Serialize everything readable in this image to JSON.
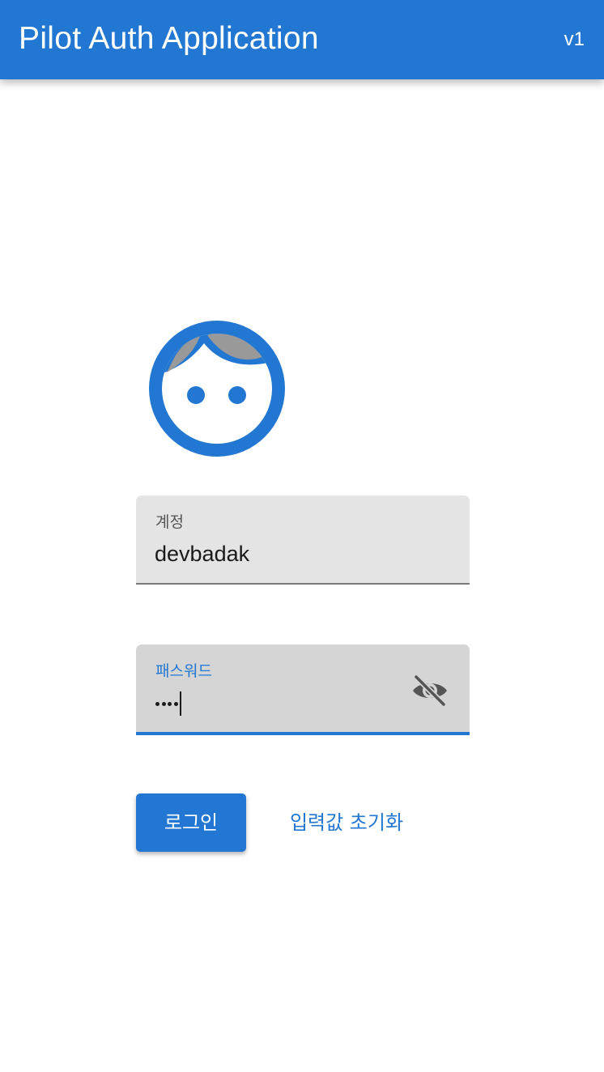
{
  "appbar": {
    "title": "Pilot Auth Application",
    "version": "v1",
    "color": "#2277d2"
  },
  "avatar": {
    "icon": "face-icon",
    "color": "#2277d2",
    "hair_color": "#9a9a9a"
  },
  "form": {
    "account": {
      "label": "계정",
      "value": "devbadak"
    },
    "password": {
      "label": "패스워드",
      "masked_length": 4,
      "visibility_icon": "visibility-off-icon",
      "focused": true
    }
  },
  "actions": {
    "login_label": "로그인",
    "reset_label": "입력값 초기화"
  }
}
